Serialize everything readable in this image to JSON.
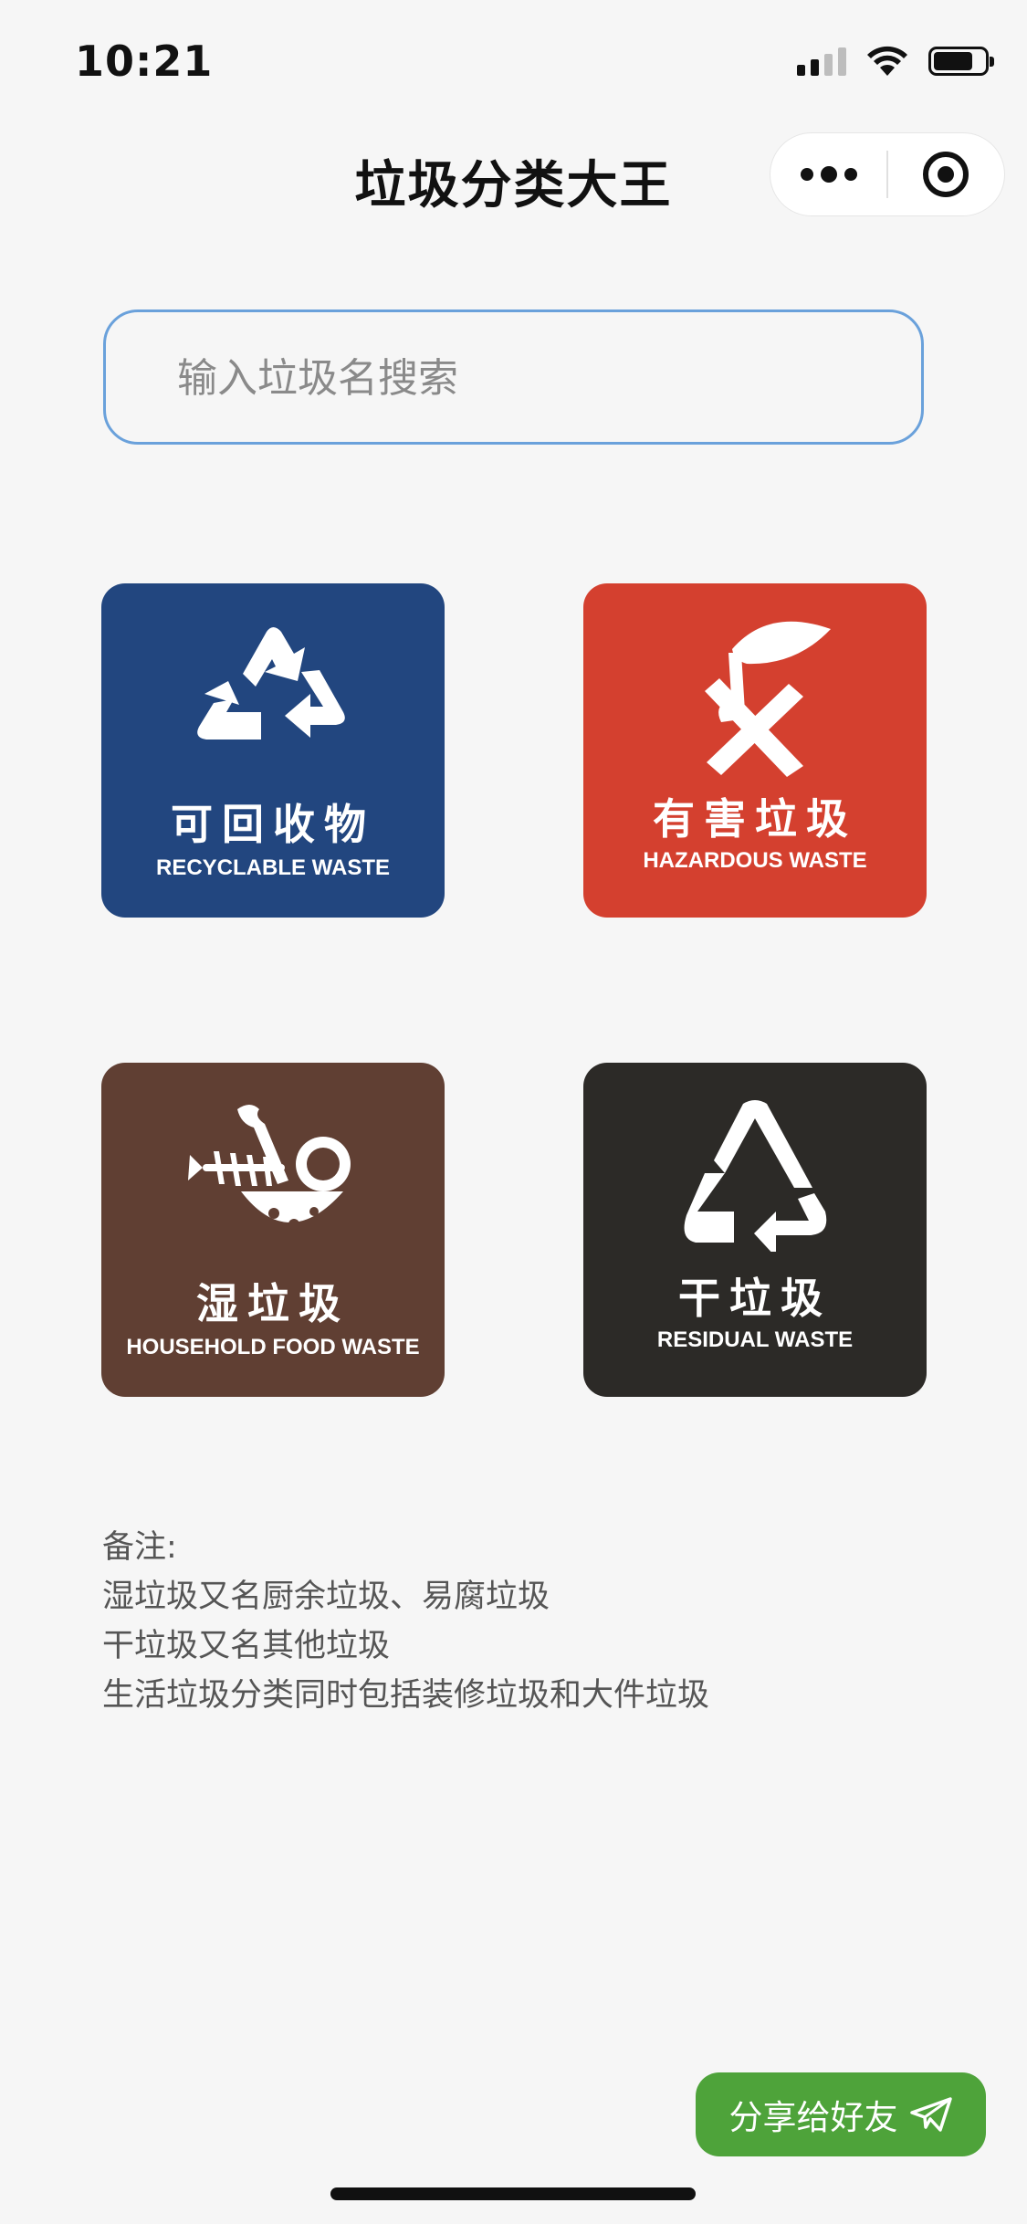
{
  "status_bar": {
    "time": "10:21",
    "icons": [
      "signal-icon",
      "wifi-icon",
      "battery-icon"
    ]
  },
  "nav": {
    "title": "垃圾分类大王",
    "menu_icon": "more-dots-icon",
    "close_icon": "target-circle-icon"
  },
  "search": {
    "placeholder": "输入垃圾名搜索",
    "value": ""
  },
  "categories": [
    {
      "label_cn": "可回收物",
      "label_en": "RECYCLABLE WASTE",
      "icon": "recycle-icon",
      "color": "#22467f"
    },
    {
      "label_cn": "有害垃圾",
      "label_en": "HAZARDOUS WASTE",
      "icon": "hazardous-icon",
      "color": "#d4402f"
    },
    {
      "label_cn": "湿垃圾",
      "label_en": "HOUSEHOLD FOOD WASTE",
      "icon": "food-waste-icon",
      "color": "#603f33"
    },
    {
      "label_cn": "干垃圾",
      "label_en": "RESIDUAL WASTE",
      "icon": "residual-icon",
      "color": "#2c2a27"
    }
  ],
  "notes": {
    "heading": "备注:",
    "lines": [
      "湿垃圾又名厨余垃圾、易腐垃圾",
      "干垃圾又名其他垃圾",
      "生活垃圾分类同时包括装修垃圾和大件垃圾"
    ]
  },
  "share": {
    "label": "分享给好友",
    "icon": "paper-plane-icon",
    "color": "#4ea33a"
  }
}
